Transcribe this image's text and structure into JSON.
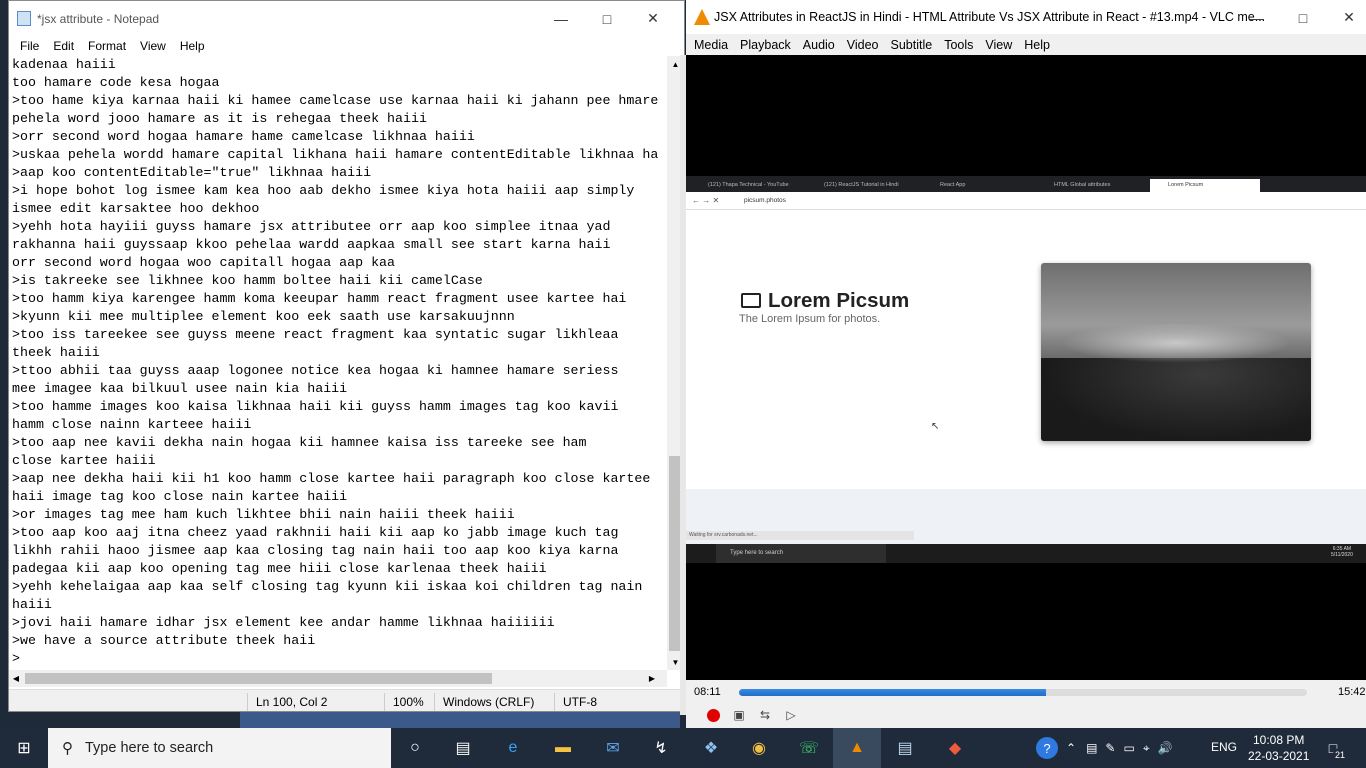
{
  "notepad": {
    "title": "*jsx attribute - Notepad",
    "menu": [
      "File",
      "Edit",
      "Format",
      "View",
      "Help"
    ],
    "lines": [
      "kadenaa haiii",
      "too hamare code kesa hogaa",
      ">too hame kiya karnaa haii ki hamee camelcase use karnaa haii ki jahann pee hmare",
      "pehela word jooo hamare as it is rehegaa theek haiii",
      ">orr second word hogaa hamare hame camelcase likhnaa haiii",
      ">uskaa pehela wordd hamare capital likhana haii hamare contentEditable likhnaa ha",
      ">aap koo contentEditable=\"true\" likhnaa haiii",
      ">i hope bohot log ismee kam kea hoo aab dekho ismee kiya hota haiii aap simply",
      "ismee edit karsaktee hoo dekhoo",
      ">yehh hota hayiii guyss hamare jsx attributee orr aap koo simplee itnaa yad",
      "rakhanna haii guyssaap kkoo pehelaa wardd aapkaa small see start karna haii",
      "orr second word hogaa woo capitall hogaa aap kaa",
      ">is takreeke see likhnee koo hamm boltee haii kii camelCase",
      ">too hamm kiya karengee hamm koma keeupar hamm react fragment usee kartee hai",
      ">kyunn kii mee multiplee element koo eek saath use karsakuujnnn",
      ">too iss tareekee see guyss meene react fragment kaa syntatic sugar likhleaa",
      "theek haiii",
      ">ttoo abhii taa guyss aaap logonee notice kea hogaa ki hamnee hamare seriess",
      "mee imagee kaa bilkuul usee nain kia haiii",
      ">too hamme images koo kaisa likhnaa haii kii guyss hamm images tag koo kavii",
      "hamm close nainn karteee haiii",
      ">too aap nee kavii dekha nain hogaa kii hamnee kaisa iss tareeke see ham",
      "close kartee haiii",
      ">aap nee dekha haii kii h1 koo hamm close kartee haii paragraph koo close kartee",
      "haii image tag koo close nain kartee haiii",
      ">or images tag mee ham kuch likhtee bhii nain haiii theek haiii",
      ">too aap koo aaj itna cheez yaad rakhnii haii kii aap ko jabb image kuch tag",
      "likhh rahii haoo jismee aap kaa closing tag nain haii too aap koo kiya karna",
      "padegaa kii aap koo opening tag mee hiii close karlenaa theek haiii",
      ">yehh kehelaigaa aap kaa self closing tag kyunn kii iskaa koi children tag nain",
      "haiii",
      ">jovi haii hamare idhar jsx element kee andar hamme likhnaa haiiiiii",
      ">we have a source attribute theek haii",
      ">"
    ],
    "status": {
      "position": "Ln 100, Col 2",
      "zoom": "100%",
      "eol": "Windows (CRLF)",
      "encoding": "UTF-8"
    }
  },
  "vlc": {
    "title": "JSX Attributes in ReactJS in Hindi - HTML Attribute Vs JSX Attribute in React  - #13.mp4 - VLC me...",
    "menu": [
      "Media",
      "Playback",
      "Audio",
      "Video",
      "Subtitle",
      "Tools",
      "View",
      "Help"
    ],
    "elapsed": "08:11",
    "total": "15:42",
    "progress": 0.54,
    "video": {
      "tabs": [
        "(121) Thapa Technical - YouTube",
        "(121) ReactJS Tutorial in Hindi",
        "React App",
        "HTML Global attributes",
        "Lorem Picsum"
      ],
      "url": "picsum.photos",
      "site_title": "Lorem Picsum",
      "site_subtitle": "The Lorem Ipsum for photos.",
      "status": "Waiting for srv.carbonads.net...",
      "inner_search": "Type here to search",
      "inner_time": "6:35 AM",
      "inner_date": "5/11/2020"
    }
  },
  "taskbar": {
    "search_placeholder": "Type here to search",
    "language": "ENG",
    "time": "10:08 PM",
    "date": "22-03-2021",
    "notifications": "21"
  }
}
